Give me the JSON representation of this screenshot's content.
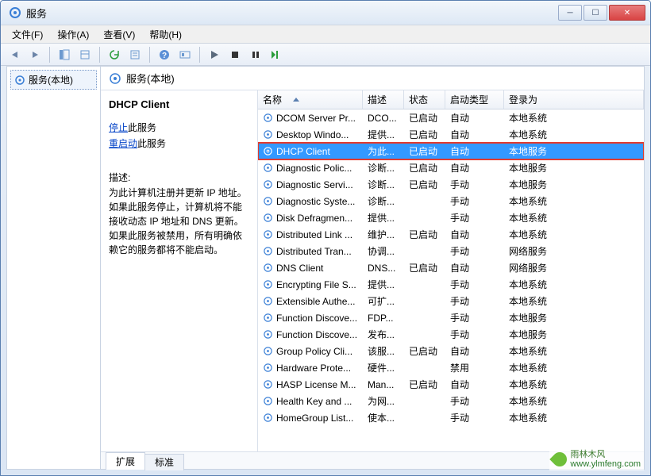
{
  "window": {
    "title": "服务"
  },
  "menu": {
    "file": "文件(F)",
    "action": "操作(A)",
    "view": "查看(V)",
    "help": "帮助(H)"
  },
  "tree": {
    "root": "服务(本地)"
  },
  "header": {
    "label": "服务(本地)"
  },
  "detail": {
    "title": "DHCP Client",
    "stop_prefix": "停止",
    "stop_suffix": "此服务",
    "restart_prefix": "重启动",
    "restart_suffix": "此服务",
    "desc_label": "描述:",
    "desc": "为此计算机注册并更新 IP 地址。如果此服务停止，计算机将不能接收动态 IP 地址和 DNS 更新。如果此服务被禁用，所有明确依赖它的服务都将不能启动。"
  },
  "columns": {
    "name": "名称",
    "desc": "描述",
    "state": "状态",
    "start": "启动类型",
    "logon": "登录为"
  },
  "services": [
    {
      "name": "DCOM Server Pr...",
      "desc": "DCO...",
      "state": "已启动",
      "start": "自动",
      "logon": "本地系统"
    },
    {
      "name": "Desktop Windo...",
      "desc": "提供...",
      "state": "已启动",
      "start": "自动",
      "logon": "本地系统"
    },
    {
      "name": "DHCP Client",
      "desc": "为此...",
      "state": "已启动",
      "start": "自动",
      "logon": "本地服务",
      "selected": true,
      "highlighted": true
    },
    {
      "name": "Diagnostic Polic...",
      "desc": "诊断...",
      "state": "已启动",
      "start": "自动",
      "logon": "本地服务"
    },
    {
      "name": "Diagnostic Servi...",
      "desc": "诊断...",
      "state": "已启动",
      "start": "手动",
      "logon": "本地服务"
    },
    {
      "name": "Diagnostic Syste...",
      "desc": "诊断...",
      "state": "",
      "start": "手动",
      "logon": "本地系统"
    },
    {
      "name": "Disk Defragmen...",
      "desc": "提供...",
      "state": "",
      "start": "手动",
      "logon": "本地系统"
    },
    {
      "name": "Distributed Link ...",
      "desc": "维护...",
      "state": "已启动",
      "start": "自动",
      "logon": "本地系统"
    },
    {
      "name": "Distributed Tran...",
      "desc": "协调...",
      "state": "",
      "start": "手动",
      "logon": "网络服务"
    },
    {
      "name": "DNS Client",
      "desc": "DNS...",
      "state": "已启动",
      "start": "自动",
      "logon": "网络服务"
    },
    {
      "name": "Encrypting File S...",
      "desc": "提供...",
      "state": "",
      "start": "手动",
      "logon": "本地系统"
    },
    {
      "name": "Extensible Authe...",
      "desc": "可扩...",
      "state": "",
      "start": "手动",
      "logon": "本地系统"
    },
    {
      "name": "Function Discove...",
      "desc": "FDP...",
      "state": "",
      "start": "手动",
      "logon": "本地服务"
    },
    {
      "name": "Function Discove...",
      "desc": "发布...",
      "state": "",
      "start": "手动",
      "logon": "本地服务"
    },
    {
      "name": "Group Policy Cli...",
      "desc": "该服...",
      "state": "已启动",
      "start": "自动",
      "logon": "本地系统"
    },
    {
      "name": "Hardware Prote...",
      "desc": "硬件...",
      "state": "",
      "start": "禁用",
      "logon": "本地系统"
    },
    {
      "name": "HASP License M...",
      "desc": "Man...",
      "state": "已启动",
      "start": "自动",
      "logon": "本地系统"
    },
    {
      "name": "Health Key and ...",
      "desc": "为网...",
      "state": "",
      "start": "手动",
      "logon": "本地系统"
    },
    {
      "name": "HomeGroup List...",
      "desc": "使本...",
      "state": "",
      "start": "手动",
      "logon": "本地系统"
    }
  ],
  "tabs": {
    "extended": "扩展",
    "standard": "标准"
  },
  "watermark": {
    "line1": "雨林木风",
    "line2": "www.ylmfeng.com"
  }
}
